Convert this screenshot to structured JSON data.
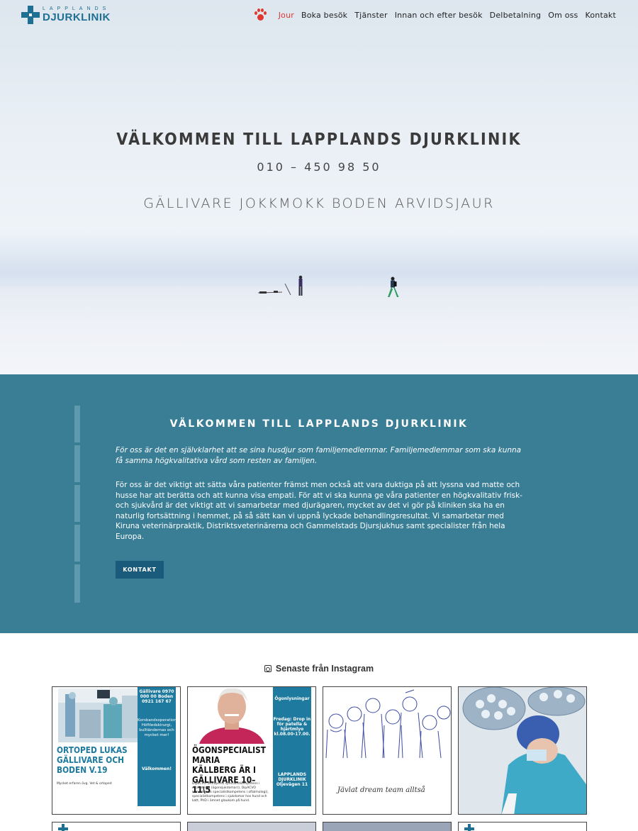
{
  "header": {
    "logo_small": "LAPPLANDS",
    "logo_big": "DJURKLINIK",
    "nav": [
      "Jour",
      "Boka besök",
      "Tjänster",
      "Innan och efter besök",
      "Delbetalning",
      "Om oss",
      "Kontakt"
    ]
  },
  "hero": {
    "title": "VÄLKOMMEN TILL LAPPLANDS DJURKLINIK",
    "phone": "010 – 450 98 50",
    "cities": "GÄLLIVARE JOKKMOKK BODEN ARVIDSJAUR"
  },
  "welcome": {
    "title": "VÄLKOMMEN TILL LAPPLANDS DJURKLINIK",
    "intro": "För oss är det en självklarhet att se sina husdjur som familjemedlemmar. Familjemedlemmar som ska kunna få samma högkvalitativa vård som resten av familjen.",
    "body": "För oss är det viktigt att sätta våra patienter främst men också att vara duktiga på att lyssna vad matte och husse har att berätta och att kunna visa empati. För att vi ska kunna ge våra patienter en högkvalitativ frisk- och sjukvård är det viktigt att vi samarbetar med djurägaren, mycket av det vi gör på kliniken ska ha en naturlig fortsättning i hemmet, på så sätt kan vi uppnå lyckade behandlingsresultat. Vi samarbetar med Kiruna veterinärpraktik, Distriktsveterinärerna och Gammelstads Djursjukhus samt specialister från hela Europa.",
    "button": "KONTAKT"
  },
  "instagram": {
    "heading": "Senaste från Instagram",
    "posts": [
      {
        "title": "ORTOPED LUKAS GÄLLIVARE OCH BODEN V.19",
        "side_top": "Gällivare 0970 000 00 Boden 0921 167 67",
        "side_mid": "Korsbandsoperation, Höftledskirurgi, bulltändernas och mycket mer!",
        "side_welcome": "Välkommen!",
        "caption": "Mycket erfaren övg. Vet & ortoped"
      },
      {
        "title": "ÖGONSPECIALIST MARIA KÄLLBERG ÄR I GÄLLIVARE 10–11\\5",
        "side_top": "Ögonlysningar",
        "side_mid": "Fredag: Drop in för patella & hjärtmlyo kl.08.00-17.00.",
        "side_bottom": "LAPPLANDS DJURKLINIK Oljevägen 11",
        "caption": "DipECVO (europeisk specialistkompetens i oftalmologi (ögonsjukdomar)), DipACVO (amerikansk specialistkompetens i oftalmologi), specialistkompetens i sjukdomar hos hund och katt, PhD i ämnet glaukom på hund."
      },
      {
        "caption": "Jävlat dream team alltså"
      },
      {
        "caption": ""
      }
    ]
  }
}
